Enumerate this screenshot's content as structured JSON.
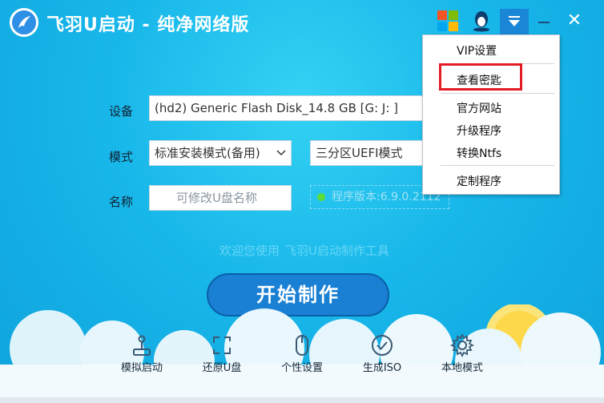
{
  "app": {
    "title": "飞羽U启动 - 纯净网络版",
    "colors": {
      "accent": "#1a80d4",
      "background": "#18b7ea",
      "highlight": "#e31b24",
      "status_dot": "#5cdc3a"
    }
  },
  "title_bar": {
    "icons": [
      "windows-logo-icon",
      "qq-penguin-icon",
      "dropdown-menu-icon",
      "minimize-icon",
      "close-icon"
    ],
    "close_glyph": "✕"
  },
  "form": {
    "device_label": "设备",
    "device_value": "(hd2) Generic Flash Disk_14.8 GB [G: J: ]",
    "mode_label": "模式",
    "mode_value": "标准安装模式(备用)",
    "partition_value": "三分区UEFI模式",
    "name_label": "名称",
    "name_placeholder": "可修改U盘名称",
    "version_text": "程序版本:6.9.0.2112"
  },
  "welcome": {
    "prefix": "欢迎您使用",
    "product": "飞羽U启动制作工具"
  },
  "start_button": "开始制作",
  "bottom_bar": {
    "items": [
      {
        "label": "模拟启动",
        "icon": "joystick-icon"
      },
      {
        "label": "还原U盘",
        "icon": "restore-icon"
      },
      {
        "label": "个性设置",
        "icon": "mouse-icon"
      },
      {
        "label": "生成ISO",
        "icon": "check-circle-icon"
      },
      {
        "label": "本地模式",
        "icon": "gear-icon"
      }
    ]
  },
  "dropdown_menu": {
    "items": [
      "VIP设置",
      "查看密匙",
      "官方网站",
      "升级程序",
      "转换Ntfs",
      "定制程序"
    ],
    "highlighted_item": "查看密匙"
  }
}
